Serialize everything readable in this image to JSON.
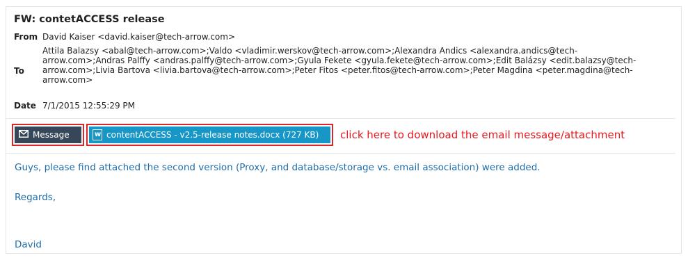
{
  "email": {
    "subject": "FW: contetACCESS release",
    "from_label": "From",
    "from_value": "David Kaiser <david.kaiser@tech-arrow.com>",
    "to_label": "To",
    "to_value": "Attila Balazsy <abal@tech-arrow.com>;Valdo <vladimir.werskov@tech-arrow.com>;Alexandra Andics <alexandra.andics@tech-arrow.com>;Andras Palffy <andras.palffy@tech-arrow.com>;Gyula Fekete <gyula.fekete@tech-arrow.com>;Edit Balázsy <edit.balazsy@tech-arrow.com>;Livia Bartova <livia.bartova@tech-arrow.com>;Peter Fitos <peter.fitos@tech-arrow.com>;Peter Magdina <peter.magdina@tech-arrow.com>",
    "to_lines": [
      "Attila Balazsy <abal@tech-arrow.com>;Valdo <vladimir.werskov@tech-arrow.com>;Alexandra Andics <alexandra.andics@tech-",
      "arrow.com>;Andras Palffy <andras.palffy@tech-arrow.com>;Gyula Fekete <gyula.fekete@tech-arrow.com>;Edit Balázsy <edit.balazsy@tech-",
      "arrow.com>;Livia Bartova <livia.bartova@tech-arrow.com>;Peter Fitos <peter.fitos@tech-arrow.com>;Peter Magdina <peter.magdina@tech-",
      "arrow.com>"
    ],
    "date_label": "Date",
    "date_value": "7/1/2015 12:55:29 PM"
  },
  "buttons": {
    "message_label": "Message",
    "message_icon": "envelope-icon",
    "attachment_label": "contentACCESS - v2.5-release notes.docx (727 KB)",
    "attachment_icon": "word-document-icon"
  },
  "annotation": {
    "text": "click here to download the email message/attachment",
    "color": "#e8181e"
  },
  "body": {
    "line1": "Guys, please find attached the second version (Proxy, and database/storage vs. email association) were added.",
    "line2": "Regards,",
    "line3": "David"
  },
  "colors": {
    "message_button_bg": "#36475a",
    "attachment_button_bg": "#1796c8",
    "highlight_border": "#d9262b",
    "body_text": "#1f6ca8"
  }
}
